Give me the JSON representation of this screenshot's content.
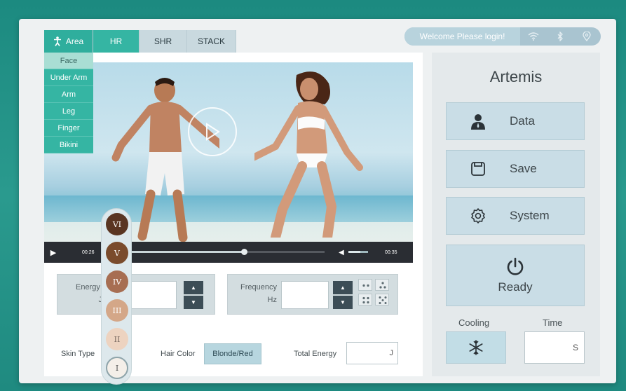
{
  "tabs": {
    "area": "Area",
    "hr": "HR",
    "shr": "SHR",
    "stack": "STACK"
  },
  "header": {
    "welcome": "Welcome Please login!",
    "icons": [
      "wifi-icon",
      "bluetooth-icon",
      "location-icon"
    ]
  },
  "area_menu": [
    "Face",
    "Under Arm",
    "Arm",
    "Leg",
    "Finger",
    "Bikini"
  ],
  "video": {
    "elapsed": "00:26",
    "duration": "00:35",
    "progress": 0.59,
    "volume": 0.6
  },
  "energy": {
    "label": "Energy De",
    "unit": "J",
    "value": ""
  },
  "frequency": {
    "label": "Frequency",
    "unit": "Hz",
    "value": ""
  },
  "skin_type": {
    "label": "Skin Type",
    "options": [
      "VI",
      "V",
      "IV",
      "III",
      "II",
      "I"
    ],
    "selected": "I",
    "colors": [
      "#5a3522",
      "#7a4b2c",
      "#a76e52",
      "#d4a788",
      "#edd3c0",
      "#f4efe9"
    ]
  },
  "hair_color": {
    "label": "Hair Color",
    "value": "Blonde/Red"
  },
  "total_energy": {
    "label": "Total Energy",
    "unit": "J",
    "value": ""
  },
  "sidebar": {
    "brand": "Artemis",
    "data_label": "Data",
    "save_label": "Save",
    "system_label": "System",
    "ready_label": "Ready",
    "cooling_label": "Cooling",
    "time_label": "Time",
    "time_unit": "S"
  },
  "colors": {
    "accent": "#35b5a3",
    "background": "#1c8a80",
    "button": "#c9dde6"
  }
}
